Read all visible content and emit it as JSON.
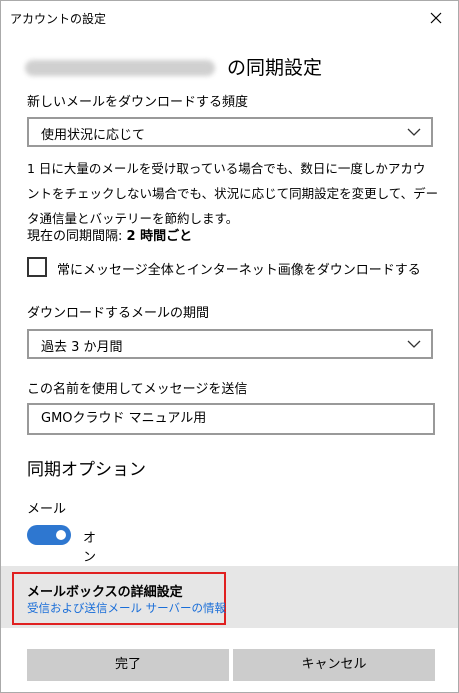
{
  "window": {
    "title": "アカウントの設定"
  },
  "heading": {
    "suffix": "の同期設定"
  },
  "download_frequency": {
    "label": "新しいメールをダウンロードする頻度",
    "selected": "使用状況に応じて"
  },
  "description": {
    "lines": [
      "1 日に大量のメールを受け取っている場合でも、数日に一度しかアカウ",
      "ントをチェックしない場合でも、状況に応じて同期設定を変更して、デー",
      "タ通信量とバッテリーを節約します。"
    ]
  },
  "interval": {
    "label": "現在の同期間隔: ",
    "value": "2 時間ごと"
  },
  "full_download": {
    "label": "常にメッセージ全体とインターネット画像をダウンロードする",
    "checked": false
  },
  "download_period": {
    "label": "ダウンロードするメールの期間",
    "selected": "過去 3 か月間"
  },
  "sender_name": {
    "label": "この名前を使用してメッセージを送信",
    "value": "GMOクラウド マニュアル用"
  },
  "sync_options": {
    "title": "同期オプション",
    "mail_label": "メール",
    "toggle_state": "オン",
    "toggle_on": true
  },
  "advanced": {
    "title": "メールボックスの詳細設定",
    "link": "受信および送信メール サーバーの情報"
  },
  "buttons": {
    "done": "完了",
    "cancel": "キャンセル"
  },
  "colors": {
    "accent": "#2e77d0",
    "link": "#1a6ed8",
    "highlight": "#e02020"
  }
}
